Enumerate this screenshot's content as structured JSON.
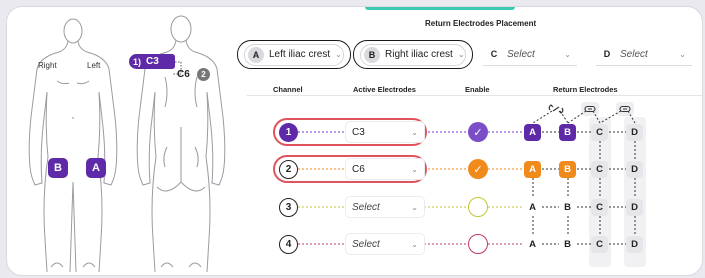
{
  "body_map": {
    "side_right": "Right",
    "side_left": "Left",
    "pads": [
      {
        "letter": "B",
        "color": "#5e2aa7"
      },
      {
        "letter": "A",
        "color": "#5e2aa7"
      }
    ],
    "spine_tag": {
      "num": "1)",
      "label": "C3"
    },
    "spine_label_2": {
      "label": "C6",
      "num": "2"
    }
  },
  "placement": {
    "title": "Return Electrodes Placement",
    "selects": [
      {
        "letter": "A",
        "value": "Left iliac crest",
        "selected": true
      },
      {
        "letter": "B",
        "value": "Right iliac crest",
        "selected": true
      },
      {
        "letter": "C",
        "value": "Select",
        "selected": false
      },
      {
        "letter": "D",
        "value": "Select",
        "selected": false
      }
    ]
  },
  "table": {
    "headers": {
      "channel": "Channel",
      "active": "Active Electrodes",
      "enable": "Enable",
      "return": "Return Electrodes"
    },
    "rows": [
      {
        "num": "1",
        "active": "C3",
        "enabled": true,
        "color": "#6d3fd0",
        "ret": [
          "A",
          "B",
          "C",
          "D"
        ],
        "ret_style": [
          "purple",
          "purple",
          "grey",
          "grey"
        ]
      },
      {
        "num": "2",
        "active": "C6",
        "enabled": true,
        "color": "#f08a1a",
        "ret": [
          "A",
          "B",
          "C",
          "D"
        ],
        "ret_style": [
          "orange",
          "orange",
          "grey",
          "grey"
        ]
      },
      {
        "num": "3",
        "active": "Select",
        "enabled": false,
        "color": "#c5c635",
        "ret": [
          "A",
          "B",
          "C",
          "D"
        ],
        "ret_style": [
          "white",
          "white",
          "grey",
          "grey"
        ]
      },
      {
        "num": "4",
        "active": "Select",
        "enabled": false,
        "color": "#c23a63",
        "ret": [
          "A",
          "B",
          "C",
          "D"
        ],
        "ret_style": [
          "white",
          "white",
          "grey",
          "grey"
        ]
      }
    ]
  },
  "icons": {
    "check": "✓",
    "chevron": "⌄",
    "unlink": "unlink-icon",
    "link": "link-icon"
  },
  "colors": {
    "brand_purple": "#5e2aa7",
    "highlight_red": "#e0535d",
    "accent_teal": "#3ec9b6"
  }
}
